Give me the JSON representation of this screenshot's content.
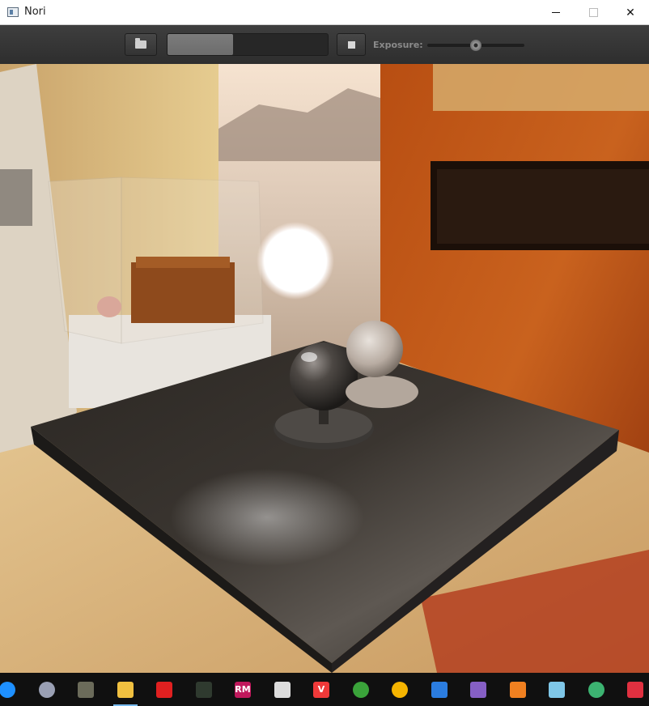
{
  "window": {
    "title": "Nori"
  },
  "toolbar": {
    "exposure_label": "Exposure:",
    "progress_fraction": 0.41,
    "exposure_value_fraction": 0.5
  },
  "render": {
    "scene_icons": {}
  },
  "taskbar": {
    "items": [
      {
        "name": "settings-app-icon",
        "color": "#1e90ff",
        "glyph": ""
      },
      {
        "name": "dvd-app-icon",
        "color": "#9aa0b4",
        "glyph": ""
      },
      {
        "name": "gimp-app-icon",
        "color": "#6b6b5a",
        "glyph": ""
      },
      {
        "name": "file-explorer-icon",
        "color": "#f0c040",
        "glyph": ""
      },
      {
        "name": "scratch-app-icon",
        "color": "#e02020",
        "glyph": ""
      },
      {
        "name": "terminal-app-icon",
        "color": "#2f3a2f",
        "glyph": ""
      },
      {
        "name": "rubymine-app-icon",
        "color": "#c0185c",
        "glyph": "RM"
      },
      {
        "name": "inkscape-app-icon",
        "color": "#dcdcdc",
        "glyph": ""
      },
      {
        "name": "vivaldi-app-icon",
        "color": "#ef3939",
        "glyph": "V"
      },
      {
        "name": "globe-app-icon",
        "color": "#3aa33a",
        "glyph": ""
      },
      {
        "name": "chrome-canary-app-icon",
        "color": "#f5b400",
        "glyph": ""
      },
      {
        "name": "network-app-icon",
        "color": "#2b7de0",
        "glyph": ""
      },
      {
        "name": "visual-studio-app-icon",
        "color": "#865fc5",
        "glyph": ""
      },
      {
        "name": "search-tool-app-icon",
        "color": "#f08020",
        "glyph": ""
      },
      {
        "name": "notes-app-icon",
        "color": "#7fc7e8",
        "glyph": ""
      },
      {
        "name": "atom-app-icon",
        "color": "#3cb371",
        "glyph": ""
      },
      {
        "name": "app-grid-icon",
        "color": "#e03040",
        "glyph": ""
      }
    ]
  }
}
